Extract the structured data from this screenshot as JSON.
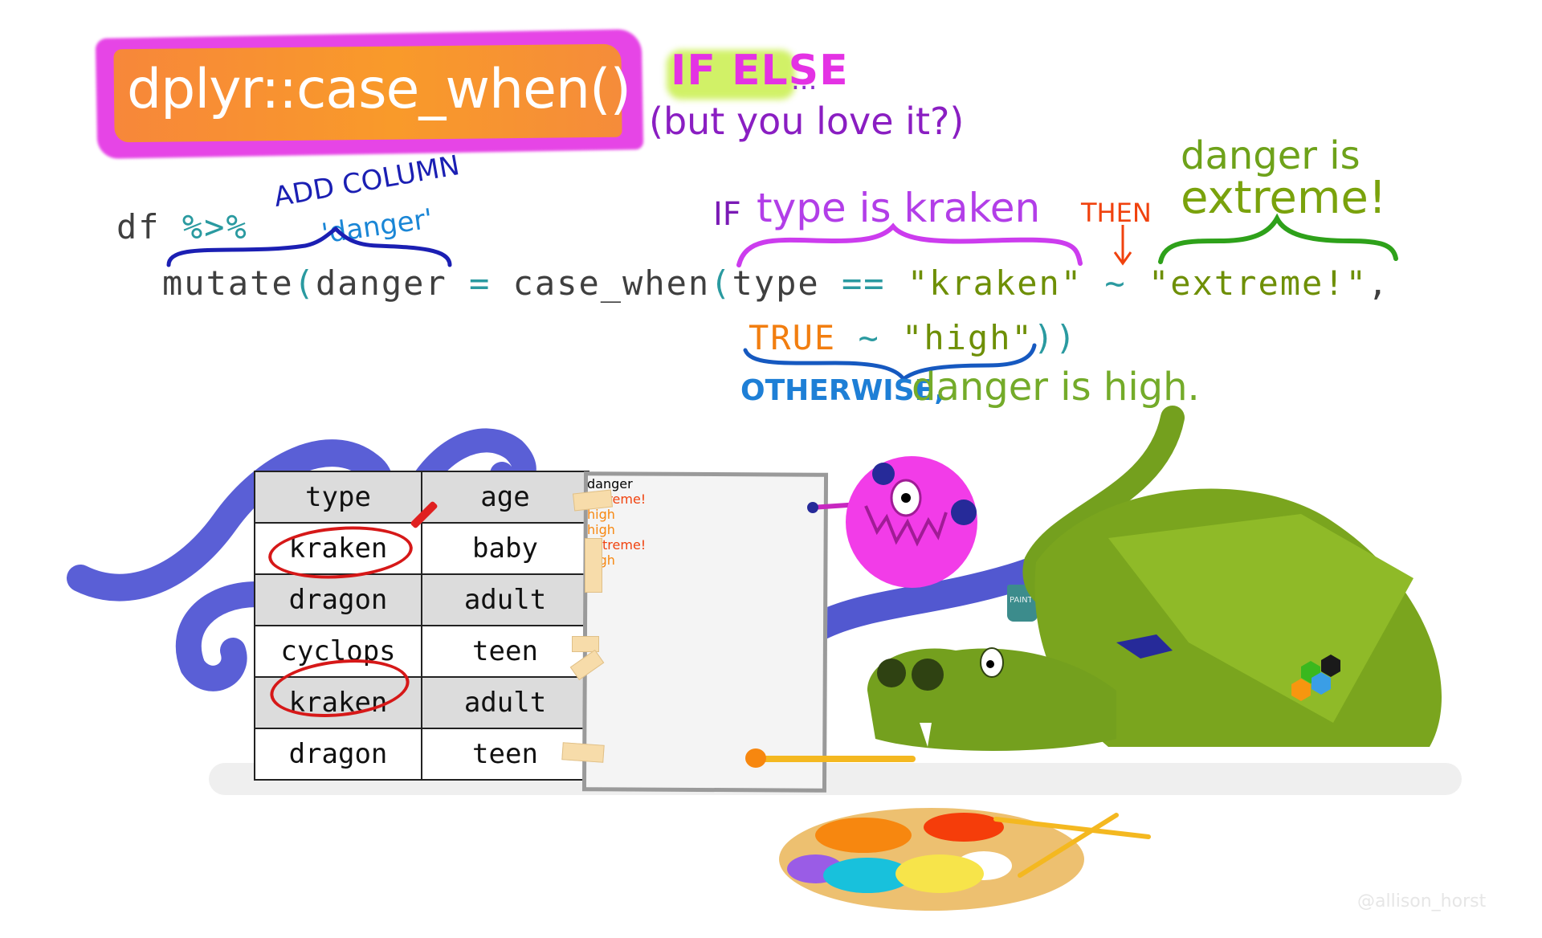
{
  "title": {
    "main": "dplyr::case_when()",
    "subtitle_highlight": "IF ELSE",
    "subtitle_dots": "...",
    "subtitle_rest": "(but you love it?)"
  },
  "code": {
    "line1": {
      "df": "df",
      "pipe": "%>%"
    },
    "line2": {
      "mutate": "mutate",
      "open_paren": "(",
      "column": "danger",
      "equals": "=",
      "func": "case_when",
      "func_paren": "(",
      "condition_var": "type",
      "operator": "==",
      "condition_value": "\"kraken\"",
      "tilde": "~",
      "result": "\"extreme!\"",
      "comma": ","
    },
    "line3": {
      "default_cond": "TRUE",
      "tilde": "~",
      "default_value": "\"high\"",
      "close": "))"
    }
  },
  "annotations": {
    "add_column": "ADD COLUMN",
    "danger_col": "'danger'",
    "if_label": "IF",
    "type_is_kraken": "type is kraken",
    "then_label": "THEN",
    "arrow": "↓",
    "danger_is": "danger is",
    "extreme": "extreme!",
    "otherwise": "OTHERWISE,",
    "otherwise_rest": "danger is high."
  },
  "table": {
    "headers": [
      "type",
      "age"
    ],
    "rows": [
      [
        "kraken",
        "baby"
      ],
      [
        "dragon",
        "adult"
      ],
      [
        "cyclops",
        "teen"
      ],
      [
        "kraken",
        "adult"
      ],
      [
        "dragon",
        "teen"
      ]
    ],
    "circled_rows": [
      0,
      3
    ]
  },
  "danger_column": {
    "header": "danger",
    "values": [
      "extreme!",
      "high",
      "high",
      "extreme!",
      "high"
    ],
    "colors": {
      "extreme!": "#f0420e",
      "high": "#f7870f"
    }
  },
  "characters": {
    "kraken_tentacles": "blue-purple",
    "cyclops": "pink",
    "dragon": "green",
    "paint_bucket_label": "PAINT",
    "hex_stickers": [
      "#3ab81e",
      "#1a1a1a",
      "#f7960f",
      "#3a9ee6"
    ]
  },
  "palette_paints": [
    "#f7870f",
    "#f53d0a",
    "#9a5ce6",
    "#18c1dc",
    "#f7e44a"
  ],
  "credit": "@allison_horst",
  "colors": {
    "title_pink": "#e645e6",
    "title_orange": "#f7873a",
    "code_gray": "#3f3f3f",
    "code_teal": "#2a9aa0",
    "code_olive": "#6e8f06",
    "code_orange": "#f27e10"
  }
}
